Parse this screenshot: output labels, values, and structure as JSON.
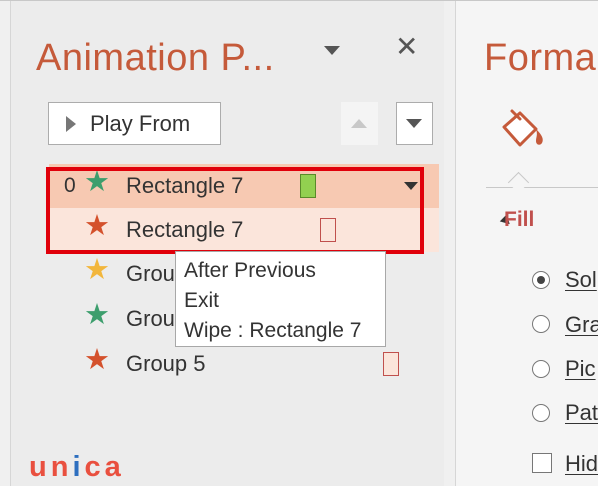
{
  "animation_pane": {
    "title": "Animation P...",
    "play_from_label": "Play From",
    "items": [
      {
        "index": "0",
        "label": "Rectangle 7",
        "star_color": "#3d9e6d"
      },
      {
        "index": "",
        "label": "Rectangle 7",
        "star_color": "#d4512c"
      },
      {
        "index": "",
        "label": "Grou",
        "star_color": "#f2b63c"
      },
      {
        "index": "",
        "label": "Grou",
        "star_color": "#3d9e6d"
      },
      {
        "index": "",
        "label": "Group 5",
        "star_color": "#d4512c"
      }
    ],
    "tooltip": {
      "line1": "After Previous",
      "line2": "Exit",
      "line3": "Wipe : Rectangle 7"
    }
  },
  "format_pane": {
    "title": "Forma",
    "section": "Fill",
    "options": [
      {
        "label": "Sol",
        "type": "radio",
        "checked": true
      },
      {
        "label": "Gra",
        "type": "radio",
        "checked": false
      },
      {
        "label": "Pic",
        "type": "radio",
        "checked": false
      },
      {
        "label": "Pat",
        "type": "radio",
        "checked": false
      },
      {
        "label": "Hid",
        "type": "checkbox",
        "checked": false
      }
    ]
  },
  "brand": {
    "part1": "un",
    "part2": "i",
    "part3": "ca"
  },
  "colors": {
    "accent": "#c55a3a",
    "selection_outline": "#e0000a",
    "selected_row": "#f7c9b2",
    "secondary_row": "#fbe5db",
    "green_bar": "#92d050"
  }
}
